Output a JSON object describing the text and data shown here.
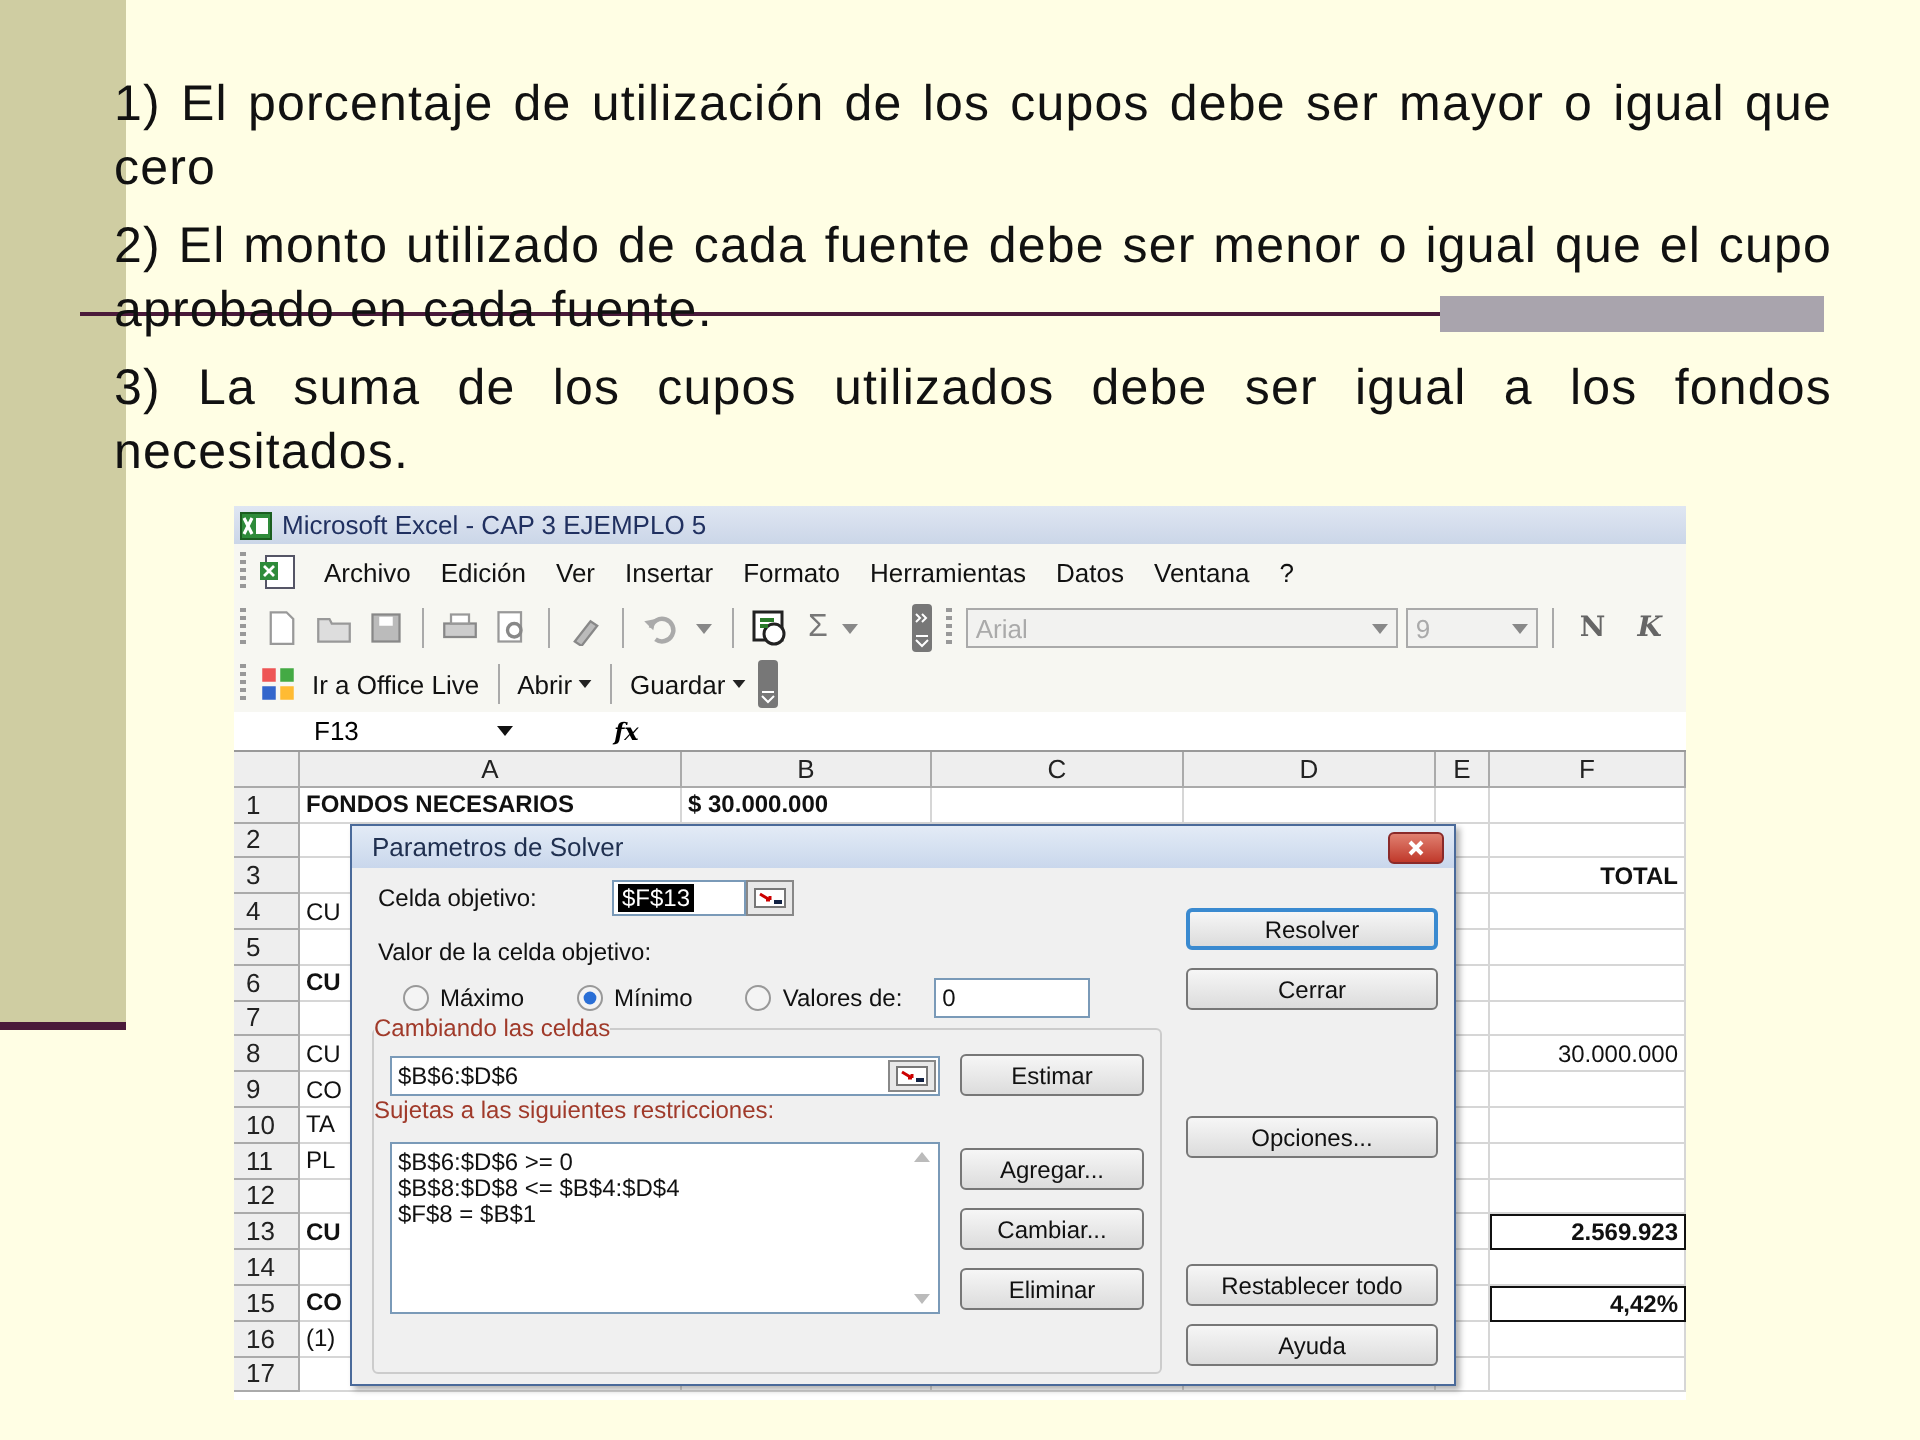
{
  "slide": {
    "paragraphs": [
      "1) El porcentaje de utilización de los cupos debe ser mayor o igual que cero",
      "2) El monto utilizado de cada fuente debe ser menor o igual que el cupo aprobado en cada fuente.",
      "3) La suma de los cupos utilizados debe ser igual a los fondos necesitados."
    ]
  },
  "excel": {
    "window_title": "Microsoft Excel - CAP 3 EJEMPLO 5",
    "menu": [
      "Archivo",
      "Edición",
      "Ver",
      "Insertar",
      "Formato",
      "Herramientas",
      "Datos",
      "Ventana",
      "?"
    ],
    "toolbar": {
      "sigma": "Σ",
      "font": {
        "value": "Arial",
        "disabled": true
      },
      "size": {
        "value": "9",
        "disabled": true
      },
      "bold": "N",
      "italic": "K"
    },
    "toolbar2": [
      {
        "label": "Ir a Office Live",
        "kind": "link"
      },
      {
        "label": "Abrir",
        "kind": "menu"
      },
      {
        "label": "Guardar",
        "kind": "menu"
      }
    ],
    "name_box": "F13",
    "fx": "fx",
    "columns": [
      "A",
      "B",
      "C",
      "D",
      "E",
      "F"
    ],
    "rows": [
      {
        "number": "1",
        "a": "FONDOS NECESARIOS",
        "b": "$ 30.000.000",
        "f": "",
        "bold": true,
        "f_boxed": false
      },
      {
        "number": "2",
        "a": "",
        "b": "",
        "f": "",
        "f_boxed": false
      },
      {
        "number": "3",
        "a": "",
        "b": "",
        "f": "TOTAL",
        "bold": true,
        "f_boxed": false
      },
      {
        "number": "4",
        "a": "CU",
        "b": "",
        "f": "",
        "bold": false,
        "f_boxed": false
      },
      {
        "number": "5",
        "a": "",
        "b": "",
        "f": "",
        "f_boxed": false
      },
      {
        "number": "6",
        "a": "CU",
        "b": "",
        "f": "",
        "bold": true,
        "f_boxed": false
      },
      {
        "number": "7",
        "a": "",
        "b": "",
        "f": "",
        "f_boxed": false
      },
      {
        "number": "8",
        "a": "CU",
        "b": "",
        "f": "30.000.000",
        "bold": false,
        "f_boxed": false
      },
      {
        "number": "9",
        "a": "CO",
        "b": "",
        "f": "",
        "bold": false,
        "f_boxed": false
      },
      {
        "number": "10",
        "a": "TA",
        "b": "",
        "f": "",
        "bold": false,
        "f_boxed": false
      },
      {
        "number": "11",
        "a": "PL",
        "b": "",
        "f": "",
        "bold": false,
        "f_boxed": false
      },
      {
        "number": "12",
        "a": "",
        "b": "",
        "f": "",
        "f_boxed": false
      },
      {
        "number": "13",
        "a": "CU",
        "b": "",
        "f": "2.569.923",
        "bold": true,
        "f_boxed": true
      },
      {
        "number": "14",
        "a": "",
        "b": "",
        "f": "",
        "f_boxed": false
      },
      {
        "number": "15",
        "a": "CO",
        "b": "",
        "f": "4,42%",
        "bold": true,
        "f_boxed": true
      },
      {
        "number": "16",
        "a": "(1)",
        "b": "",
        "f": "",
        "bold": false,
        "f_boxed": false
      },
      {
        "number": "17",
        "a": "",
        "b": "",
        "f": "",
        "f_boxed": false
      }
    ],
    "dialog": {
      "title": "Parametros de Solver",
      "target_label": "Celda objetivo:",
      "target_value": "$F$13",
      "value_label": "Valor de la celda objetivo:",
      "options": [
        {
          "label": "Máximo",
          "selected": false
        },
        {
          "label": "Mínimo",
          "selected": true
        },
        {
          "label": "Valores de:",
          "selected": false
        }
      ],
      "value_field": "0",
      "changing_label": "Cambiando las celdas",
      "changing_value": "$B$6:$D$6",
      "guess_button": "Estimar",
      "constraints_label": "Sujetas a las siguientes restricciones:",
      "constraints": [
        "$B$6:$D$6 >= 0",
        "$B$8:$D$8 <= $B$4:$D$4",
        "$F$8 = $B$1"
      ],
      "constraint_buttons": [
        "Agregar...",
        "Cambiar...",
        "Eliminar"
      ],
      "side_buttons": [
        {
          "label": "Resolver",
          "default": true
        },
        {
          "label": "Cerrar",
          "default": false
        },
        {
          "label": "Opciones...",
          "default": false
        },
        {
          "label": "Restablecer todo",
          "default": false
        },
        {
          "label": "Ayuda",
          "default": false
        }
      ]
    }
  }
}
